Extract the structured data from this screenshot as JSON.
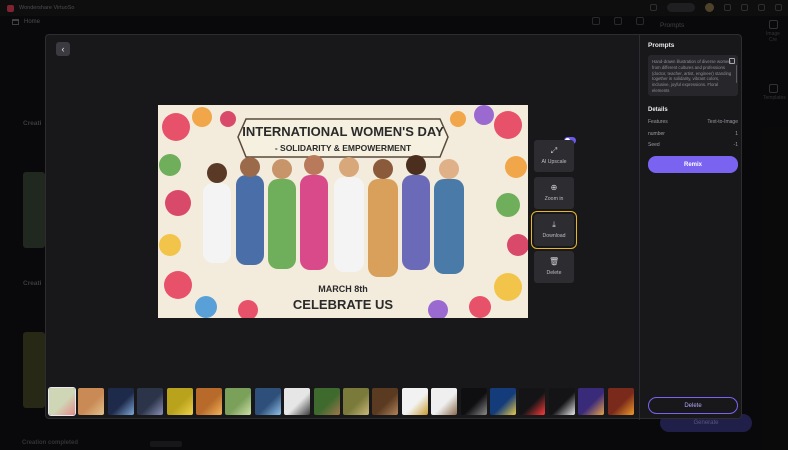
{
  "app": {
    "title": "Wondershare VirtuoSo"
  },
  "header": {
    "home_label": "Home",
    "prompts_tab": "Prompts"
  },
  "right_rail": [
    {
      "label": "Image Cre"
    },
    {
      "label": "Templates"
    }
  ],
  "background": {
    "section_title_1": "Creati",
    "section_title_2": "Creati",
    "bottom_label": "Creation completed",
    "generate_label": "Generate"
  },
  "viewer": {
    "image_alt": "International Women's Day illustration",
    "poster_title": "INTERNATIONAL WOMEN'S DAY",
    "poster_subtitle": "- SOLIDARITY & EMPOWERMENT",
    "poster_date": "MARCH 8th",
    "poster_footer": "CELEBRATE US"
  },
  "tools": {
    "upscale": "AI Upscale",
    "zoom": "Zoom in",
    "download": "Download",
    "delete": "Delete"
  },
  "panel": {
    "prompts_title": "Prompts",
    "prompt_text": "Hand-drawn illustration of diverse women from different cultures and professions (doctor, teacher, artist, engineer) standing together in solidarity, vibrant colors, inclusive, joyful expressions. Floral elements",
    "details_title": "Details",
    "details": [
      {
        "key": "Features",
        "value": "Text-to-Image"
      },
      {
        "key": "number",
        "value": "1"
      },
      {
        "key": "Seed",
        "value": "-1"
      }
    ],
    "remix_label": "Remix",
    "delete_label": "Delete"
  },
  "thumbnails": [
    {
      "color": "#cfd6b5",
      "accent": "#e58a8a"
    },
    {
      "color": "#c98a56",
      "accent": "#e2c18c"
    },
    {
      "color": "#1e2a4a",
      "accent": "#7fa8d8"
    },
    {
      "color": "#2b3448",
      "accent": "#8b90b8"
    },
    {
      "color": "#b9a21c",
      "accent": "#f0d24a"
    },
    {
      "color": "#b76a2a",
      "accent": "#f1b35a"
    },
    {
      "color": "#7aa05a",
      "accent": "#cfe0a6"
    },
    {
      "color": "#2d4f7a",
      "accent": "#8fc1e8"
    },
    {
      "color": "#e6e6e6",
      "accent": "#3a3a3a"
    },
    {
      "color": "#3e6a2e",
      "accent": "#a0764a"
    },
    {
      "color": "#7a7a3a",
      "accent": "#c8b77a"
    },
    {
      "color": "#5a3a20",
      "accent": "#b0845a"
    },
    {
      "color": "#f2f2f2",
      "accent": "#c99a2e"
    },
    {
      "color": "#efefef",
      "accent": "#8a6a4a"
    },
    {
      "color": "#0f0f12",
      "accent": "#8c8c8c"
    },
    {
      "color": "#143c7a",
      "accent": "#e8c94a"
    },
    {
      "color": "#141416",
      "accent": "#ff3b3b"
    },
    {
      "color": "#141416",
      "accent": "#e8e8e8"
    },
    {
      "color": "#3a2a7a",
      "accent": "#e8a24a"
    },
    {
      "color": "#7a2a1a",
      "accent": "#f09a2a"
    }
  ]
}
